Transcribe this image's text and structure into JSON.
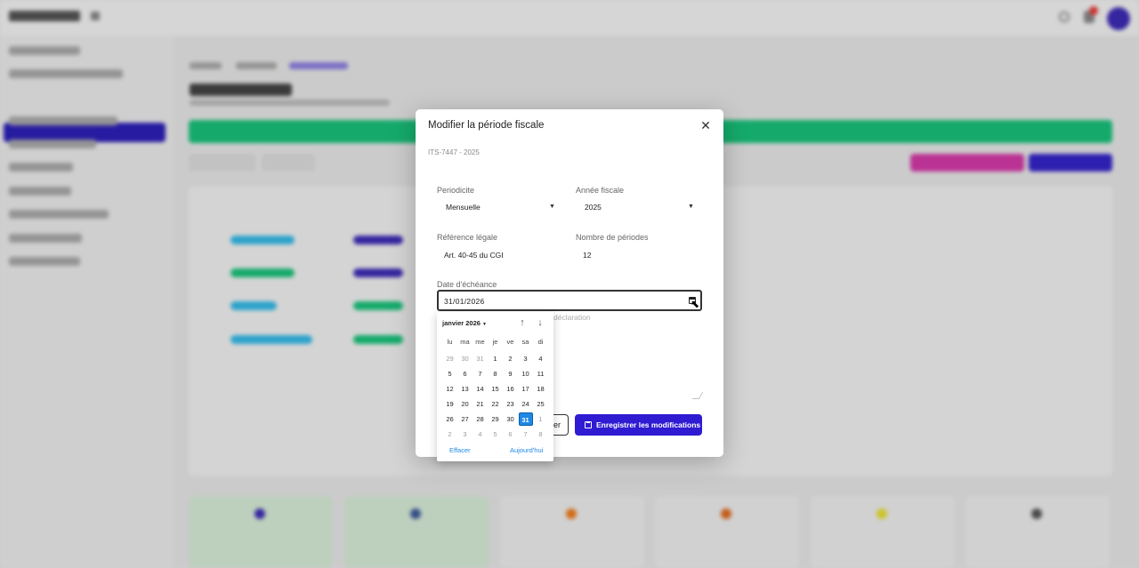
{
  "modal": {
    "title": "Modifier la période fiscale",
    "subtitle": "ITS-7447 - 2025",
    "periodicite": {
      "label": "Periodicite",
      "value": "Mensuelle"
    },
    "annee": {
      "label": "Année fiscale",
      "value": "2025"
    },
    "reference": {
      "label": "Référence légale",
      "value": "Art. 40-45 du CGI"
    },
    "nombre": {
      "label": "Nombre de périodes",
      "value": "12"
    },
    "echeance": {
      "label": "Date d'échéance",
      "value": "31/01/2026"
    },
    "helper_text": "déclaration",
    "cancel_label": "er",
    "save_label": "Enregistrer les modifications"
  },
  "datepicker": {
    "month_label": "janvier 2026",
    "weekdays": [
      "lu",
      "ma",
      "me",
      "je",
      "ve",
      "sa",
      "di"
    ],
    "weeks": [
      [
        "29",
        "30",
        "31",
        "1",
        "2",
        "3",
        "4"
      ],
      [
        "5",
        "6",
        "7",
        "8",
        "9",
        "10",
        "11"
      ],
      [
        "12",
        "13",
        "14",
        "15",
        "16",
        "17",
        "18"
      ],
      [
        "19",
        "20",
        "21",
        "22",
        "23",
        "24",
        "25"
      ],
      [
        "26",
        "27",
        "28",
        "29",
        "30",
        "31",
        "1"
      ],
      [
        "2",
        "3",
        "4",
        "5",
        "6",
        "7",
        "8"
      ]
    ],
    "muted": [
      [
        0,
        0
      ],
      [
        0,
        1
      ],
      [
        0,
        2
      ],
      [
        4,
        6
      ],
      [
        5,
        0
      ],
      [
        5,
        1
      ],
      [
        5,
        2
      ],
      [
        5,
        3
      ],
      [
        5,
        4
      ],
      [
        5,
        5
      ],
      [
        5,
        6
      ]
    ],
    "selected": [
      4,
      5
    ],
    "clear_label": "Effacer",
    "today_label": "Aujourd'hui"
  },
  "colors": {
    "accent": "#2f1bd2",
    "selected_day": "#1e88e5",
    "banner": "#18c27a"
  }
}
